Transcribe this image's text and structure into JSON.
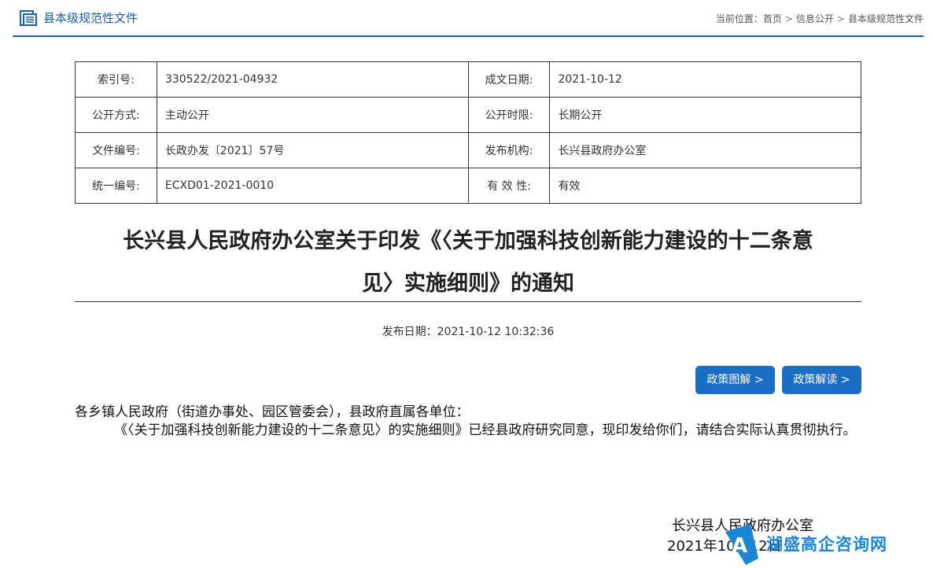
{
  "header": {
    "category": "县本级规范性文件",
    "breadcrumb_prefix": "当前位置：",
    "breadcrumb": [
      "首页",
      "信息公开",
      "县本级规范性文件"
    ]
  },
  "meta": {
    "rows": [
      {
        "k1": "索引号:",
        "v1": "330522/2021-04932",
        "k2": "成文日期:",
        "v2": "2021-10-12"
      },
      {
        "k1": "公开方式:",
        "v1": "主动公开",
        "k2": "公开时限:",
        "v2": "长期公开"
      },
      {
        "k1": "文件编号:",
        "v1": "长政办发〔2021〕57号",
        "k2": "发布机构:",
        "v2": "长兴县政府办公室"
      },
      {
        "k1": "统一编号:",
        "v1": "ECXD01-2021-0010",
        "k2": "有 效 性:",
        "v2": "有效"
      }
    ]
  },
  "article": {
    "title_line1": "长兴县人民政府办公室关于印发《〈关于加强科技创新能力建设的十二条意",
    "title_line2": "见〉实施细则》的通知",
    "pubdate": "发布日期：2021-10-12 10:32:36",
    "btn_graphic": "政策图解 >",
    "btn_reading": "政策解读 >",
    "greeting": "各乡镇人民政府（街道办事处、园区管委会），县政府直属各单位：",
    "paragraph": "《〈关于加强科技创新能力建设的十二条意见〉的实施细则》已经县政府研究同意，现印发给你们，请结合实际认真贯彻执行。",
    "signature_org": "长兴县人民政府办公室",
    "signature_date": "2021年10月12日"
  },
  "watermark": {
    "text": "湖盛高企咨询网"
  },
  "colors": {
    "accent": "#1a5fa8",
    "button": "#1a6fc4"
  }
}
